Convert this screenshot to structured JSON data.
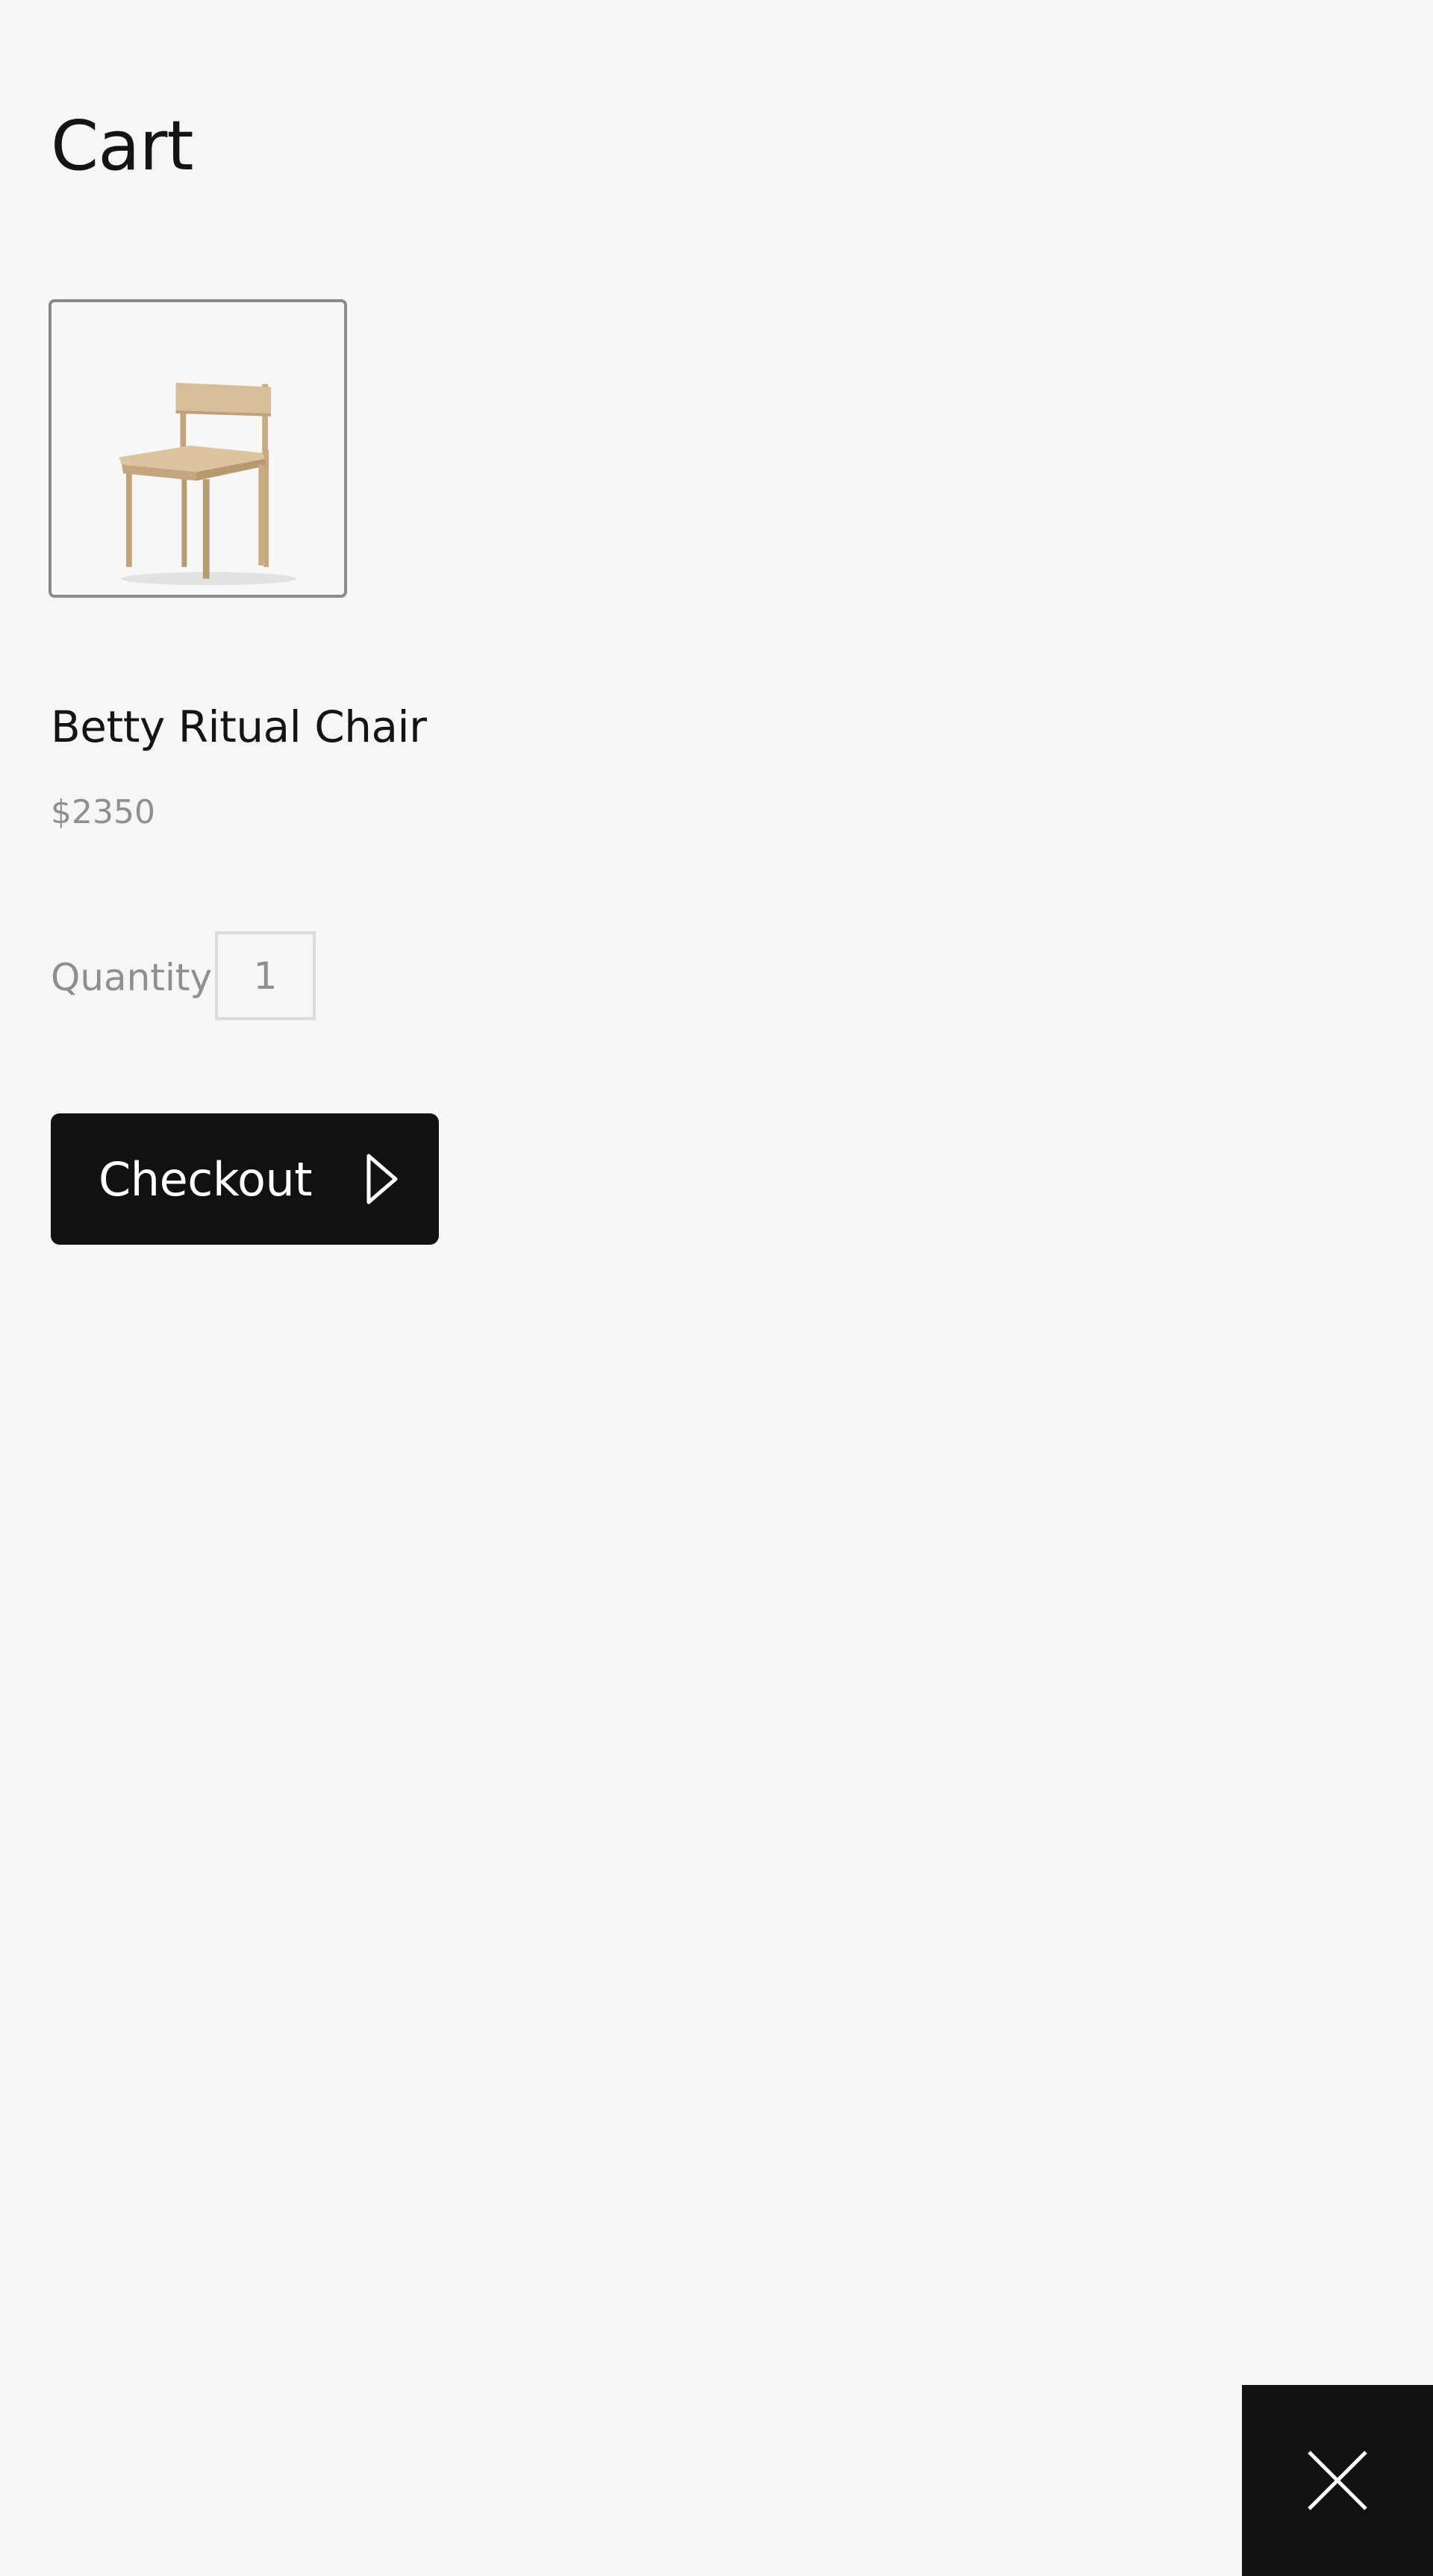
{
  "header": {
    "title": "Cart"
  },
  "cart": {
    "items": [
      {
        "name": "Betty Ritual Chair",
        "price": "$2350",
        "quantity_label": "Quantity",
        "quantity": "1",
        "image_icon": "chair-image"
      }
    ],
    "checkout_label": "Checkout",
    "checkout_icon": "play-arrow-icon"
  },
  "overlay": {
    "close_icon": "close-icon"
  },
  "colors": {
    "background": "#f6f6f6",
    "button": "#111111",
    "muted_text": "#8f8f8f",
    "chair_wood": "#d3b994"
  }
}
